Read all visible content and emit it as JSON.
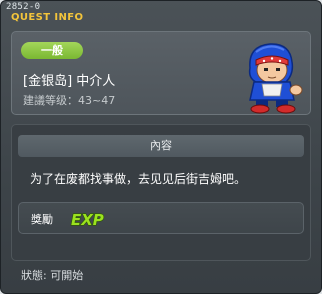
{
  "window": {
    "id": "2852-0",
    "title": "QUEST INFO"
  },
  "quest": {
    "category": "一般",
    "name": "[金银岛] 中介人",
    "level": "建議等级：43~47",
    "avatar_icon": "character-avatar"
  },
  "content": {
    "header": "內容",
    "description": "为了在废都找事做，去见见后街吉姆吧。"
  },
  "reward": {
    "label": "獎勵",
    "icon": "exp-icon",
    "icon_text": "EXP"
  },
  "status": {
    "text": "狀態: 可開始"
  },
  "colors": {
    "title_accent": "#f3c43b",
    "category_badge": "#8cc63f",
    "exp_icon": "#9be21f"
  }
}
